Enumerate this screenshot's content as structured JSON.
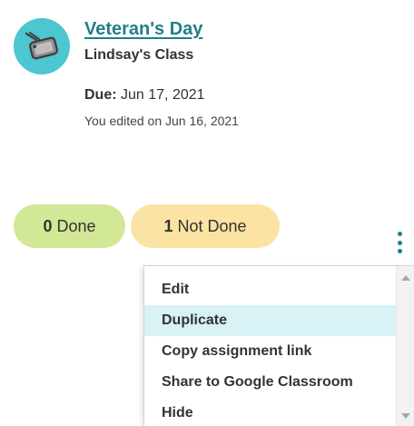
{
  "assignment": {
    "title": "Veteran's Day",
    "class_name": "Lindsay's Class",
    "due_label": "Due:",
    "due_date": "Jun 17, 2021",
    "edited_text": "You edited on Jun 16, 2021",
    "icon": "dog-tag-icon"
  },
  "status": {
    "done_count": "0",
    "done_label": "Done",
    "not_done_count": "1",
    "not_done_label": "Not Done"
  },
  "more": {
    "icon": "kebab-menu-icon"
  },
  "menu": {
    "items": [
      {
        "label": "Edit"
      },
      {
        "label": "Duplicate"
      },
      {
        "label": "Copy assignment link"
      },
      {
        "label": "Share to Google Classroom"
      },
      {
        "label": "Hide"
      }
    ],
    "highlighted_index": 1
  },
  "colors": {
    "accent": "#1f7f88",
    "avatar_bg": "#4cc6cf",
    "done_bg": "#d2e896",
    "not_done_bg": "#fbe3a3",
    "menu_highlight": "#d8f2f5"
  }
}
